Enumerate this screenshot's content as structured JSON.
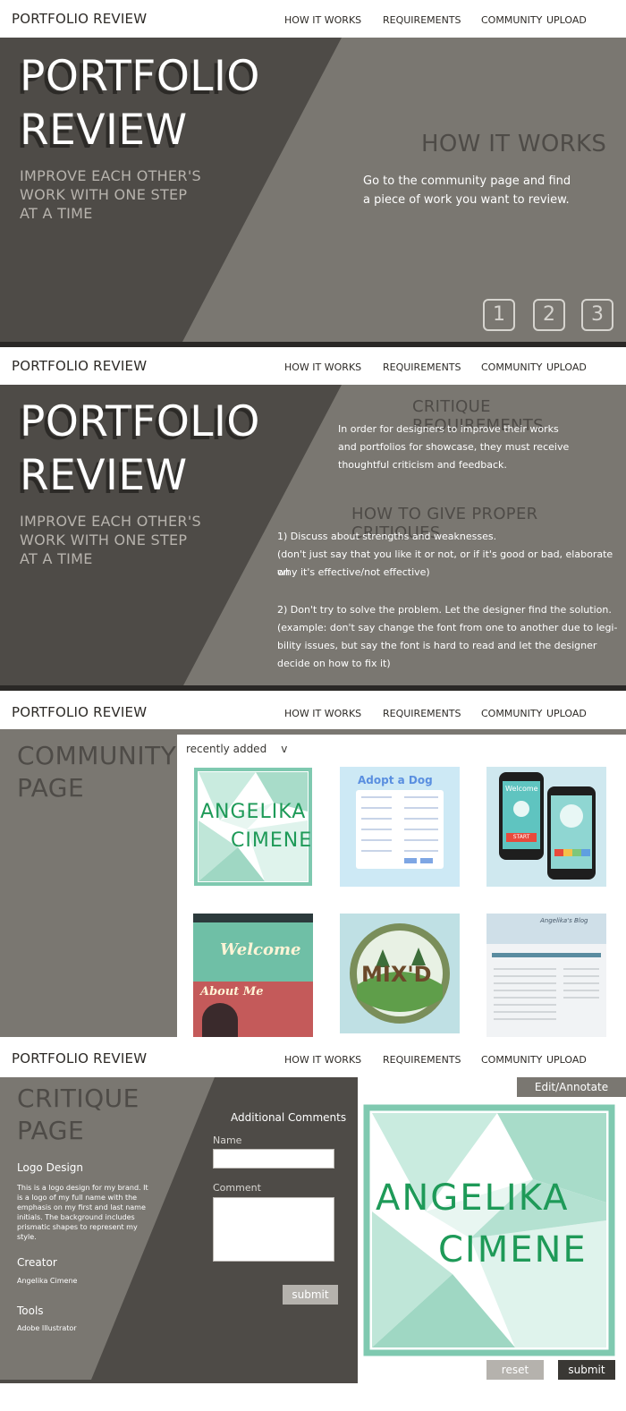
{
  "nav": {
    "brand": "PORTFOLIO REVIEW",
    "links": [
      "HOW IT WORKS",
      "REQUIREMENTS",
      "COMMUNITY",
      "UPLOAD"
    ]
  },
  "hero": {
    "title_line1": "PORTFOLIO",
    "title_line2": "REVIEW",
    "tagline": [
      "IMPROVE EACH OTHER'S",
      "WORK WITH ONE STEP",
      "AT A TIME"
    ]
  },
  "how_it_works": {
    "heading": "HOW IT WORKS",
    "text": [
      "Go to the community page and find",
      "a piece of work you want to review."
    ],
    "steps": [
      "1",
      "2",
      "3"
    ]
  },
  "requirements": {
    "heading": "CRITIQUE REQUIREMENTS",
    "intro": [
      "In order for designers to improve their works",
      "and portfolios for showcase, they must receive",
      "thoughtful criticism and feedback."
    ],
    "subheading": "HOW TO GIVE PROPER CRITIQUES",
    "points": [
      "1) Discuss about strengths and weaknesses.",
      "(don't just say that you like it or not, or if it's good or bad, elaborate on",
      "why it's effective/not effective)",
      "",
      "2) Don't try to solve the problem. Let the designer find the solution.",
      "(example: don't say change the font from one to another due to legi-",
      "bility issues, but say the font is hard to read and let the designer",
      "decide on how to fix it)"
    ]
  },
  "community": {
    "title_line1": "COMMUNITY",
    "title_line2": "PAGE",
    "sort_label": "recently added",
    "sort_caret": "v",
    "thumbs": {
      "logo_line1": "ANGELIKA",
      "logo_line2": "CIMENE",
      "adopt_title": "Adopt a Dog",
      "phone_text": "Welcome",
      "phone_button": "START",
      "welcome_title": "Welcome",
      "about_title": "About Me",
      "mixd_text": "MIX'D",
      "blog_title": "Angelika's Blog"
    }
  },
  "critique": {
    "title_line1": "CRITIQUE",
    "title_line2": "PAGE",
    "work_title": "Logo Design",
    "work_desc": [
      "This is a logo design for my brand. It",
      "is a logo of my full name with the",
      "emphasis on my first and last name",
      "initials. The background includes",
      "prismatic shapes to represent my",
      "style."
    ],
    "creator_label": "Creator",
    "creator_name": "Angelika Cimene",
    "tools_label": "Tools",
    "tools_value": "Adobe Illustrator",
    "form_heading": "Additional Comments",
    "name_label": "Name",
    "comment_label": "Comment",
    "submit_label": "submit",
    "edit_label": "Edit/Annotate",
    "logo_line1": "ANGELIKA",
    "logo_line2": "CIMENE",
    "reset_label": "reset",
    "submit2_label": "submit"
  },
  "colors": {
    "dark": "#4e4b47",
    "mid": "#7a7771",
    "mint": "#7fc9b0",
    "green_text": "#1e9a58"
  }
}
